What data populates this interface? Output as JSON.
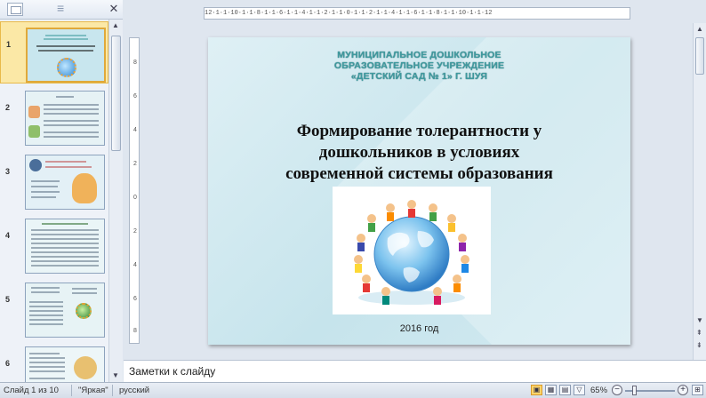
{
  "left_pane": {
    "close_glyph": "✕",
    "slides": [
      {
        "number": "1",
        "selected": true
      },
      {
        "number": "2",
        "selected": false
      },
      {
        "number": "3",
        "selected": false
      },
      {
        "number": "4",
        "selected": false
      },
      {
        "number": "5",
        "selected": false
      },
      {
        "number": "6",
        "selected": false
      }
    ]
  },
  "ruler": {
    "horizontal": "12·1·1·10·1·1·8·1·1·6·1·1·4·1·1·2·1·1·0·1·1·2·1·1·4·1·1·6·1·1·8·1·1·10·1·1·12",
    "vertical": [
      "8",
      "6",
      "4",
      "2",
      "0",
      "2",
      "4",
      "6",
      "8"
    ]
  },
  "slide": {
    "org_line1": "МУНИЦИПАЛЬНОЕ  ДОШКОЛЬНОЕ",
    "org_line2": "ОБРАЗОВАТЕЛЬНОЕ УЧРЕЖДЕНИЕ",
    "org_line3": "«ДЕТСКИЙ САД № 1» Г. ШУЯ",
    "title_line1": "Формирование  толерантности у",
    "title_line2": "дошкольников в условиях",
    "title_line3": "современной системы образования",
    "year": "2016 год"
  },
  "notes": {
    "placeholder": "Заметки к слайду"
  },
  "status_bar": {
    "slide_counter": "Слайд 1 из 10",
    "theme": "\"Яркая\"",
    "language": "русский",
    "zoom": "65%"
  },
  "colors": {
    "org_text": "#3f9a9f",
    "selection": "#fbe8a6",
    "slide_bg": "#c6e4ec"
  }
}
